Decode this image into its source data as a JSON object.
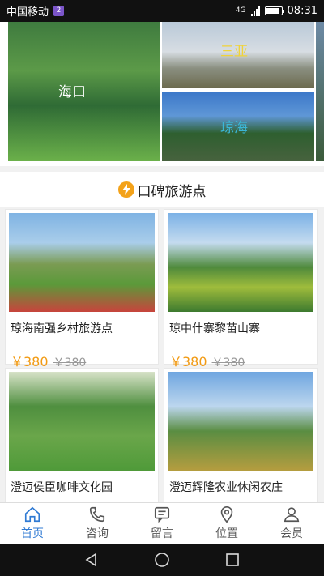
{
  "statusbar": {
    "carrier": "中国移动",
    "sim_badge": "2",
    "network": "4G",
    "time": "08:31"
  },
  "banners": [
    {
      "label": "海口"
    },
    {
      "label": "三亚"
    },
    {
      "label": "琼海"
    }
  ],
  "section": {
    "title": "口碑旅游点"
  },
  "spots": [
    {
      "name": "琼海南强乡村旅游点",
      "price": "￥380",
      "original_price": "￥380"
    },
    {
      "name": "琼中什寨黎苗山寨",
      "price": "￥380",
      "original_price": "￥380"
    },
    {
      "name": "澄迈侯臣咖啡文化园",
      "price": "",
      "original_price": ""
    },
    {
      "name": "澄迈辉隆农业休闲农庄",
      "price": "",
      "original_price": ""
    }
  ],
  "tabs": [
    {
      "label": "首页",
      "icon": "home-icon"
    },
    {
      "label": "咨询",
      "icon": "phone-icon"
    },
    {
      "label": "留言",
      "icon": "message-icon"
    },
    {
      "label": "位置",
      "icon": "location-icon"
    },
    {
      "label": "会员",
      "icon": "user-icon"
    }
  ],
  "colors": {
    "accent": "#2f7ad3",
    "price": "#f29b14",
    "bolt": "#f3a21a"
  }
}
